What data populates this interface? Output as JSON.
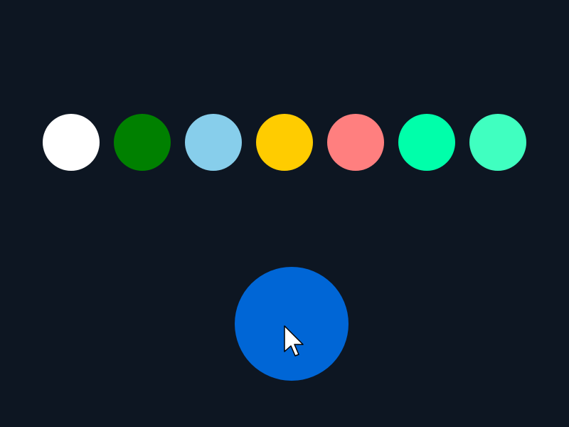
{
  "background_color": "#0d1622",
  "swatches": [
    {
      "name": "white",
      "color": "#ffffff"
    },
    {
      "name": "green",
      "color": "#008000"
    },
    {
      "name": "light-blue",
      "color": "#87ceeb"
    },
    {
      "name": "yellow",
      "color": "#ffcc00"
    },
    {
      "name": "salmon",
      "color": "#ff7f7f"
    },
    {
      "name": "spring-green",
      "color": "#00ffaa"
    },
    {
      "name": "aquamarine",
      "color": "#40ffc0"
    }
  ],
  "target": {
    "name": "target-circle",
    "color": "#0066d6"
  },
  "cursor": {
    "icon": "mouse-pointer-icon"
  }
}
